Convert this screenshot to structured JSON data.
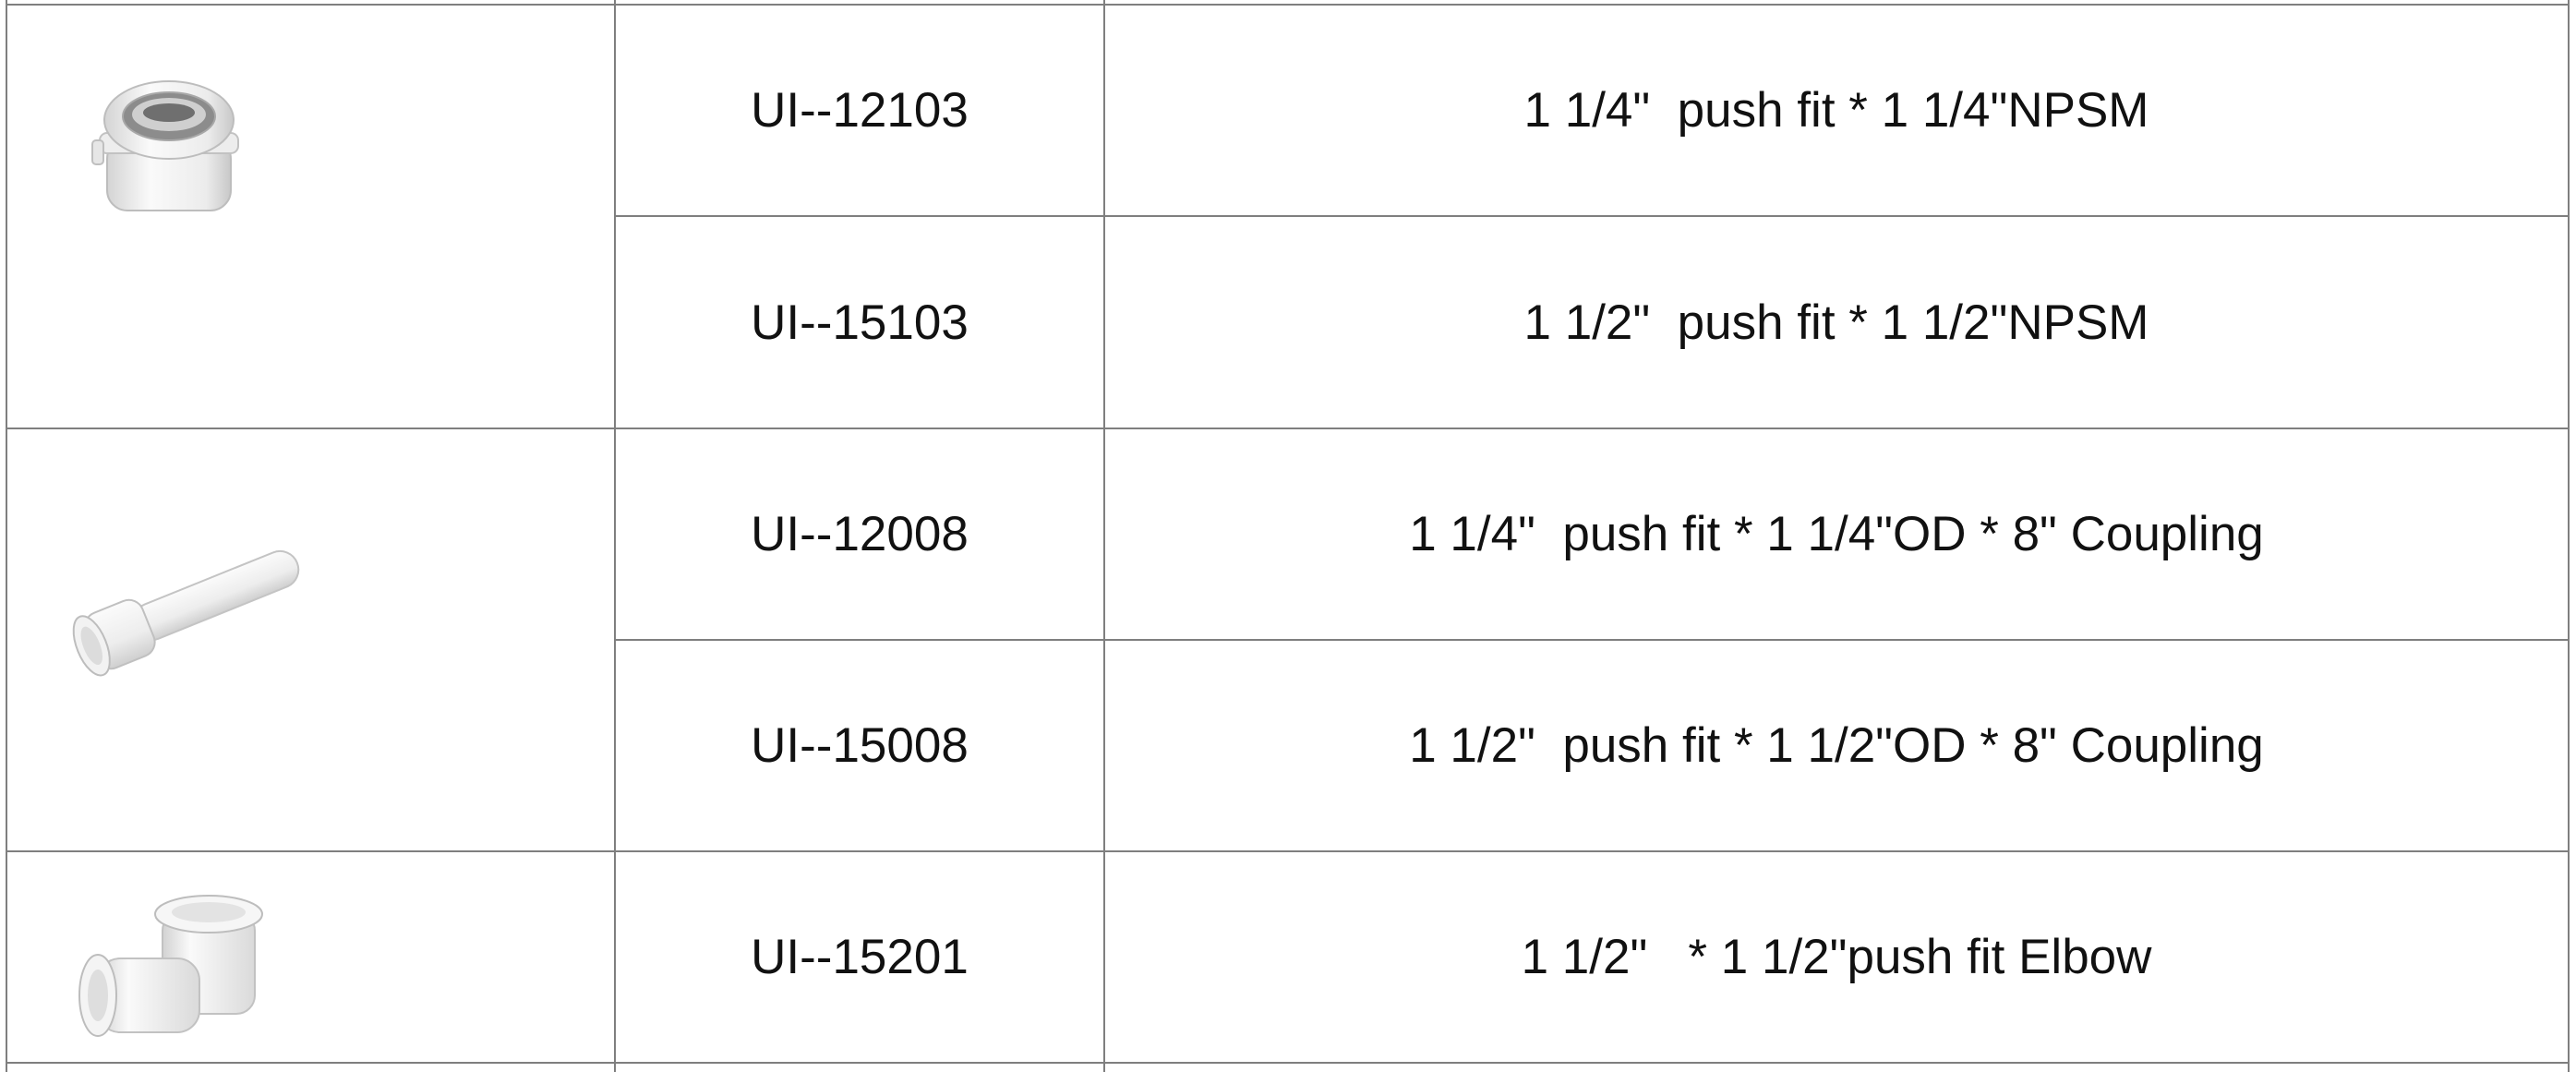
{
  "table": {
    "groups": [
      {
        "image_icon": "push-fit-npsm-adapter-icon",
        "rows": [
          {
            "code": "UI--12103",
            "description": "1 1/4\"  push fit * 1 1/4\"NPSM"
          },
          {
            "code": "UI--15103",
            "description": "1 1/2\"  push fit * 1 1/2\"NPSM"
          }
        ]
      },
      {
        "image_icon": "push-fit-coupling-tube-icon",
        "rows": [
          {
            "code": "UI--12008",
            "description": "1 1/4\"  push fit * 1 1/4\"OD * 8\" Coupling"
          },
          {
            "code": "UI--15008",
            "description": "1 1/2\"  push fit * 1 1/2\"OD * 8\" Coupling"
          }
        ]
      },
      {
        "image_icon": "push-fit-elbow-icon",
        "rows": [
          {
            "code": "UI--15201",
            "description": "1 1/2\"   * 1 1/2\"push fit Elbow"
          }
        ]
      }
    ]
  },
  "colors": {
    "grid_line": "#7f7f7f",
    "text": "#111111",
    "fitting_white": "#f4f4f4",
    "fitting_shadow": "#c9c9c9"
  }
}
